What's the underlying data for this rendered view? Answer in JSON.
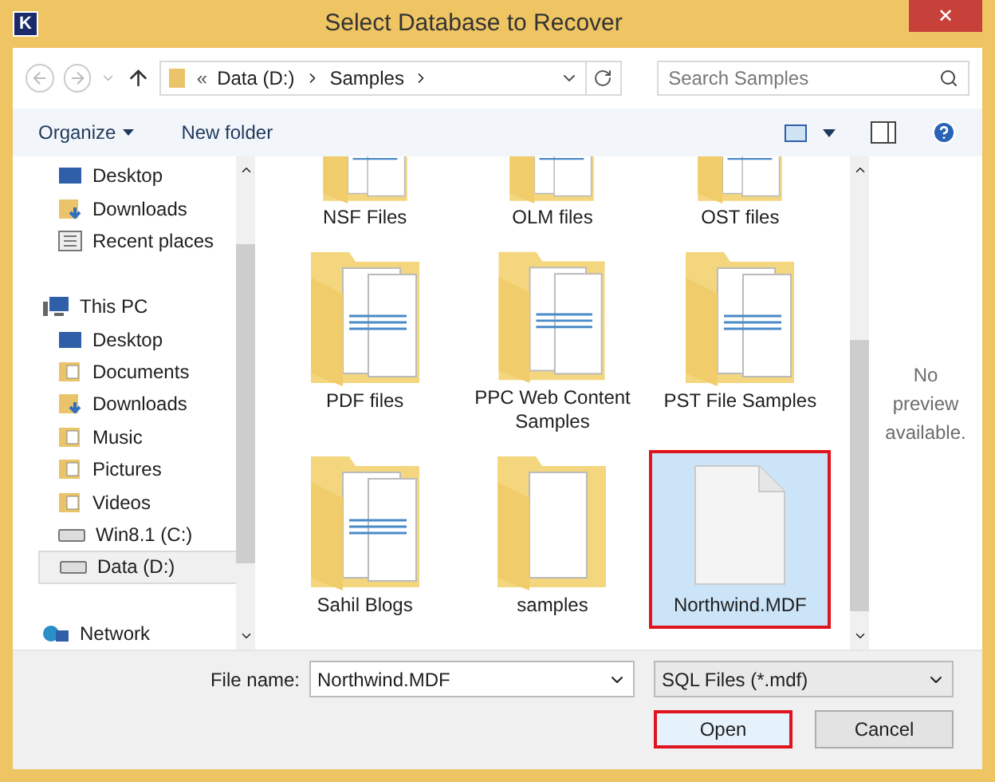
{
  "window": {
    "title": "Select Database to Recover",
    "app_badge": "K",
    "close": "✕"
  },
  "address": {
    "overflow": "«",
    "crumbs": [
      "Data (D:)",
      "Samples"
    ]
  },
  "search": {
    "placeholder": "Search Samples"
  },
  "toolbar": {
    "organize": "Organize",
    "new_folder": "New folder"
  },
  "nav": [
    {
      "children": [
        {
          "label": "Desktop",
          "kind": "desktop",
          "selected": false
        },
        {
          "label": "Downloads",
          "kind": "download",
          "selected": false
        },
        {
          "label": "Recent places",
          "kind": "recent",
          "selected": false
        }
      ]
    },
    {
      "label": "This PC",
      "kind": "pc",
      "selected": false,
      "children": [
        {
          "label": "Desktop",
          "kind": "desktop",
          "selected": false
        },
        {
          "label": "Documents",
          "kind": "folder",
          "selected": false
        },
        {
          "label": "Downloads",
          "kind": "download",
          "selected": false
        },
        {
          "label": "Music",
          "kind": "folder",
          "selected": false
        },
        {
          "label": "Pictures",
          "kind": "folder",
          "selected": false
        },
        {
          "label": "Videos",
          "kind": "folder",
          "selected": false
        },
        {
          "label": "Win8.1 (C:)",
          "kind": "drive",
          "selected": false
        },
        {
          "label": "Data (D:)",
          "kind": "drive",
          "selected": true
        }
      ]
    },
    {
      "label": "Network",
      "kind": "network",
      "selected": false
    }
  ],
  "items": [
    {
      "label": "NSF Files",
      "kind": "folder-partial",
      "selected": false
    },
    {
      "label": "OLM files",
      "kind": "folder-partial",
      "selected": false
    },
    {
      "label": "OST files",
      "kind": "folder-partial",
      "selected": false
    },
    {
      "label": "PDF files",
      "kind": "folder",
      "selected": false
    },
    {
      "label": "PPC Web Content Samples",
      "kind": "folder",
      "selected": false
    },
    {
      "label": "PST File Samples",
      "kind": "folder",
      "selected": false
    },
    {
      "label": "Sahil Blogs",
      "kind": "folder",
      "selected": false
    },
    {
      "label": "samples",
      "kind": "folder-empty",
      "selected": false
    },
    {
      "label": "Northwind.MDF",
      "kind": "file",
      "selected": true
    }
  ],
  "preview": "No preview available.",
  "file_name": {
    "label": "File name:",
    "value": "Northwind.MDF"
  },
  "file_type": {
    "value": "SQL Files (*.mdf)"
  },
  "buttons": [
    {
      "label": "Open",
      "kind": "primary"
    },
    {
      "label": "Cancel",
      "kind": "secondary"
    }
  ]
}
